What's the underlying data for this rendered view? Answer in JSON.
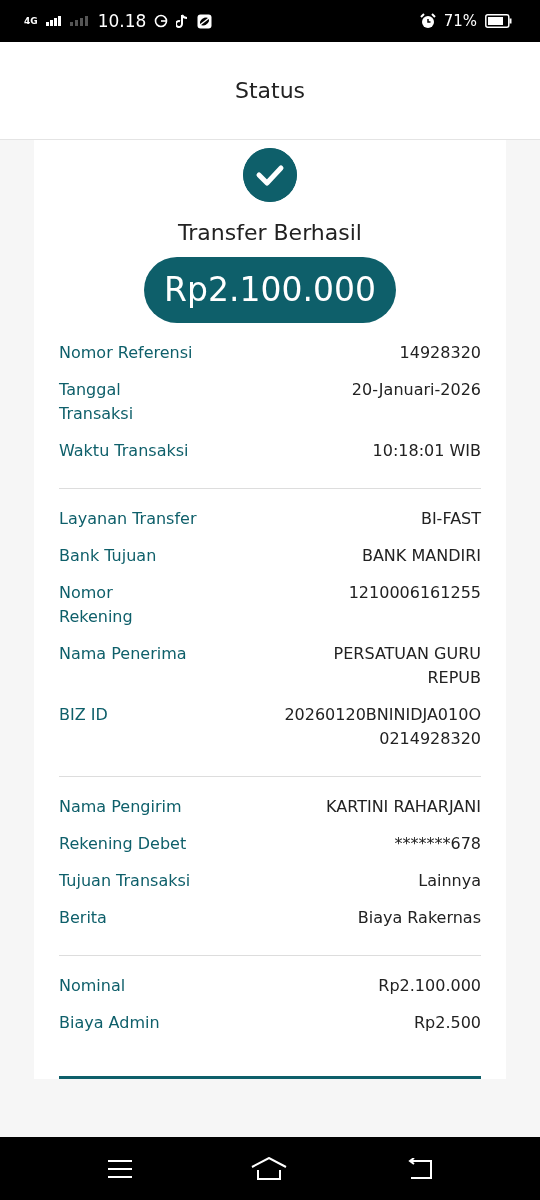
{
  "status_bar": {
    "network": "4G",
    "time": "10.18",
    "battery": "71%"
  },
  "header": {
    "title": "Status"
  },
  "receipt": {
    "result": "Transfer Berhasil",
    "amount": "Rp2.100.000",
    "sections": [
      [
        {
          "label": "Nomor Referensi",
          "value": "14928320"
        },
        {
          "label": "Tanggal\nTransaksi",
          "value": "20-Januari-2026"
        },
        {
          "label": "Waktu Transaksi",
          "value": "10:18:01 WIB"
        }
      ],
      [
        {
          "label": "Layanan Transfer",
          "value": "BI-FAST"
        },
        {
          "label": "Bank Tujuan",
          "value": "BANK MANDIRI"
        },
        {
          "label": "Nomor\nRekening",
          "value": "1210006161255"
        },
        {
          "label": "Nama Penerima",
          "value": "PERSATUAN GURU\nREPUB"
        },
        {
          "label": "BIZ ID",
          "value": "20260120BNINIDJA010O\n0214928320"
        }
      ],
      [
        {
          "label": "Nama Pengirim",
          "value": "KARTINI RAHARJANI"
        },
        {
          "label": "Rekening Debet",
          "value": "*******678"
        },
        {
          "label": "Tujuan Transaksi",
          "value": "Lainnya"
        },
        {
          "label": "Berita",
          "value": "Biaya Rakernas"
        }
      ],
      [
        {
          "label": "Nominal",
          "value": "Rp2.100.000"
        },
        {
          "label": "Biaya Admin",
          "value": "Rp2.500"
        }
      ]
    ]
  }
}
